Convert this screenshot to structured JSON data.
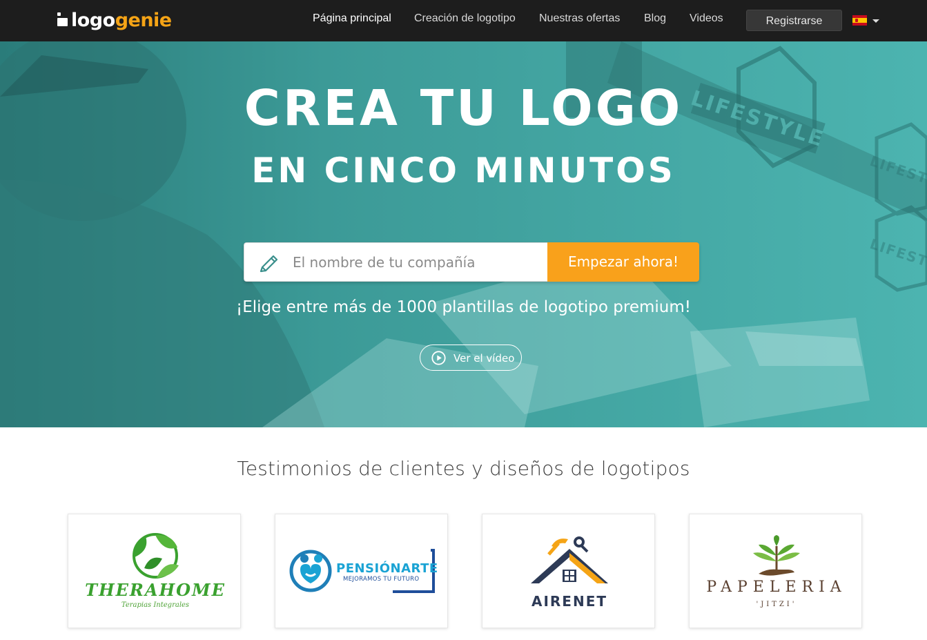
{
  "nav": {
    "brand_part1": "logo",
    "brand_part2": "genie",
    "items": [
      "Página principal",
      "Creación de logotipo",
      "Nuestras ofertas",
      "Blog",
      "Videos"
    ],
    "register_label": "Registrarse",
    "language_flag": "spain-flag"
  },
  "hero": {
    "title_line1": "CREA TU LOGO",
    "title_line2": "EN CINCO MINUTOS",
    "search_placeholder": "El nombre de tu compañía",
    "cta_label": "Empezar ahora!",
    "subtitle": "¡Elige entre más de 1000 plantillas de logotipo premium!",
    "video_label": "Ver el vídeo",
    "background_sign_text": "LIFESTYLE"
  },
  "testimonials": {
    "title": "Testimonios de clientes y diseños de logotipos",
    "logos": [
      {
        "name": "THERAHOME",
        "tagline": "Terapias Integrales"
      },
      {
        "name": "PENSIÓNARTE",
        "tagline": "MEJORAMOS TU FUTURO"
      },
      {
        "name": "AIRENET",
        "tagline": ""
      },
      {
        "name": "PAPELERIA",
        "tagline": "'JITZI'"
      }
    ]
  },
  "colors": {
    "navbar": "#1d1d1d",
    "brand_accent": "#f5a416",
    "hero_teal": "#46aeaa",
    "cta_orange": "#f9a11b"
  }
}
